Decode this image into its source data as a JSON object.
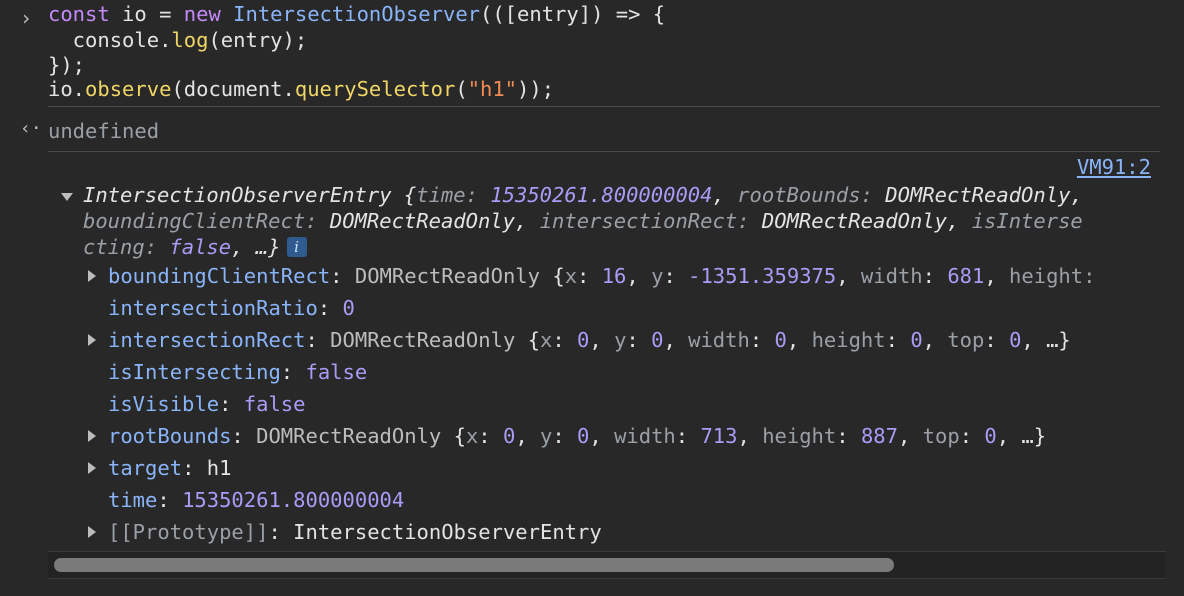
{
  "input": {
    "line1": {
      "kw1": "const",
      "var": " io = ",
      "kw2": "new",
      "cls": "IntersectionObserver",
      "rest": "(([entry]) => {"
    },
    "line2": {
      "pre": "  console.",
      "fn": "log",
      "post": "(entry);"
    },
    "line3": "});",
    "line4": {
      "pre": "io.",
      "fn1": "observe",
      "mid": "(document.",
      "fn2": "querySelector",
      "p1": "(",
      "str": "\"h1\"",
      "p2": "));"
    }
  },
  "result": {
    "undefined_text": "undefined"
  },
  "source_link": "VM91:2",
  "entry": {
    "summary_l1": {
      "name": "IntersectionObserverEntry",
      "brace": " {",
      "k1": "time",
      "v1": "15350261.800000004",
      "k2": "rootBounds",
      "v2": "DOMRectReadOnly,"
    },
    "summary_l2": {
      "k3": "boundingClientRect",
      "v3": "DOMRectReadOnly",
      "k4": "intersectionRect",
      "v4": "DOMRectReadOnly",
      "k5": "isInterse"
    },
    "summary_l3": {
      "k5b": "cting",
      "v5": "false",
      "tail": ", …}"
    },
    "info_icon": "i",
    "props": {
      "boundingClientRect": {
        "key": "boundingClientRect",
        "type": "DOMRectReadOnly",
        "x": "16",
        "y": "-1351.359375",
        "width": "681",
        "height_key": "height:"
      },
      "intersectionRatio": {
        "key": "intersectionRatio",
        "value": "0"
      },
      "intersectionRect": {
        "key": "intersectionRect",
        "type": "DOMRectReadOnly",
        "x": "0",
        "y": "0",
        "width": "0",
        "height": "0",
        "top": "0"
      },
      "isIntersecting": {
        "key": "isIntersecting",
        "value": "false"
      },
      "isVisible": {
        "key": "isVisible",
        "value": "false"
      },
      "rootBounds": {
        "key": "rootBounds",
        "type": "DOMRectReadOnly",
        "x": "0",
        "y": "0",
        "width": "713",
        "height": "887",
        "top": "0"
      },
      "target": {
        "key": "target",
        "value": "h1"
      },
      "time": {
        "key": "time",
        "value": "15350261.800000004"
      },
      "prototype": {
        "key": "[[Prototype]]",
        "value": "IntersectionObserverEntry"
      }
    }
  },
  "scrollbar": {
    "thumb_fraction": 0.75
  },
  "icons": [
    "prompt-chevron-icon",
    "result-arrow-icon",
    "expand-triangle-icon",
    "collapse-triangle-icon",
    "info-icon"
  ]
}
